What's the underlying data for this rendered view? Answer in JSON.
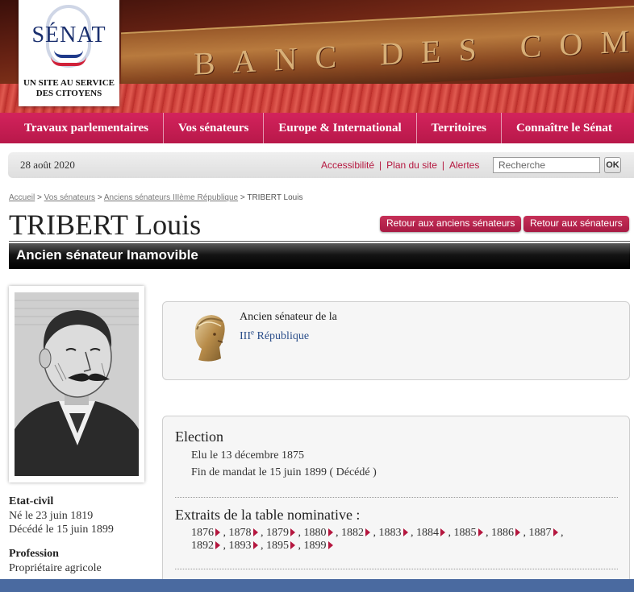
{
  "header": {
    "logo_name": "SÉNAT",
    "logo_tagline": "UN SITE AU SERVICE DES CITOYENS",
    "banner_text": "BANC DES COMM"
  },
  "nav": {
    "items": [
      {
        "label": "Travaux parlementaires"
      },
      {
        "label": "Vos sénateurs"
      },
      {
        "label": "Europe & International"
      },
      {
        "label": "Territoires"
      },
      {
        "label": "Connaître le Sénat"
      }
    ]
  },
  "utility": {
    "date": "28 août 2020",
    "links": [
      "Accessibilité",
      "Plan du site",
      "Alertes"
    ],
    "search_placeholder": "Recherche",
    "search_button": "OK"
  },
  "breadcrumb": {
    "items": [
      "Accueil",
      "Vos sénateurs",
      "Anciens sénateurs IIIème République"
    ],
    "current": "TRIBERT Louis",
    "separator": ">"
  },
  "page": {
    "title": "TRIBERT Louis",
    "back_former_label": "Retour aux anciens sénateurs",
    "back_current_label": "Retour aux sénateurs",
    "subtitle": "Ancien sénateur Inamovible"
  },
  "sidebar": {
    "civil_label": "Etat-civil",
    "born": "Né le 23 juin 1819",
    "died": "Décédé le 15 juin 1899",
    "profession_label": "Profession",
    "profession": "Propriétaire agricole"
  },
  "republic_box": {
    "line1": "Ancien sénateur de la",
    "roman": "III",
    "sup": "e",
    "link": " République"
  },
  "election": {
    "title": "Election",
    "elected": "Elu le 13 décembre 1875",
    "end": "Fin de mandat le 15 juin 1899 ( Décédé )",
    "extracts_title": "Extraits de la table nominative :",
    "years": [
      "1876",
      "1878",
      "1879",
      "1880",
      "1882",
      "1883",
      "1884",
      "1885",
      "1886",
      "1887",
      "1892",
      "1893",
      "1895",
      "1899"
    ]
  },
  "colors": {
    "brand_pink": "#c2204f",
    "link_red": "#b5173f",
    "link_blue": "#2b4e8a",
    "footer_blue": "#4a6aa0"
  }
}
